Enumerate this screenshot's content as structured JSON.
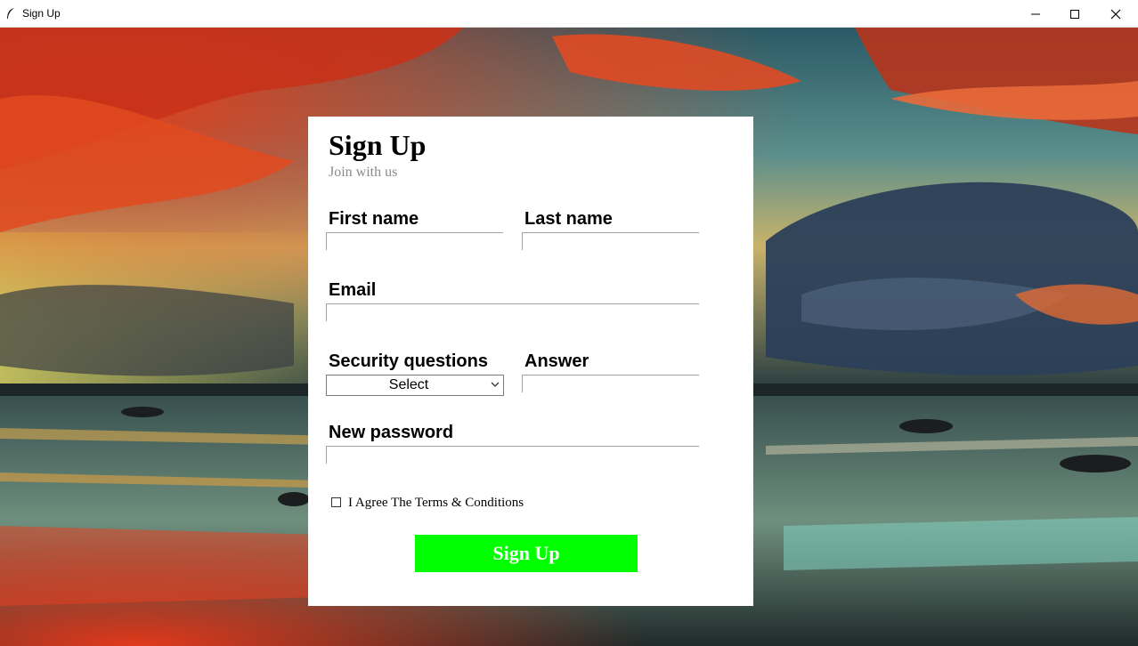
{
  "window": {
    "title": "Sign Up"
  },
  "form": {
    "title": "Sign Up",
    "subtitle": "Join with us",
    "first_name_label": "First name",
    "last_name_label": "Last name",
    "email_label": "Email",
    "security_label": "Security questions",
    "security_selected": "Select",
    "answer_label": "Answer",
    "password_label": "New password",
    "agree_label": "I Agree The Terms & Conditions",
    "submit_label": "Sign Up"
  },
  "colors": {
    "submit_bg": "#00ff00",
    "panel_bg": "#ffffff",
    "subtitle": "#8a8a8a"
  },
  "icons": {
    "app": "feather-icon",
    "minimize": "minimize-icon",
    "maximize": "maximize-icon",
    "close": "close-icon",
    "dropdown": "chevron-down-icon"
  }
}
